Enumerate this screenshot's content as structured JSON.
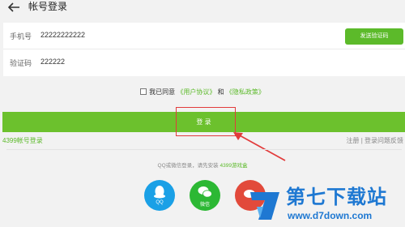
{
  "header": {
    "title": "帐号登录"
  },
  "form": {
    "phone_label": "手机号",
    "phone_value": "22222222222",
    "send_code_label": "发送验证码",
    "code_label": "验证码",
    "code_value": "222222"
  },
  "agreement": {
    "prefix": "我已同意",
    "user_agreement": "《用户协议》",
    "and": "和",
    "privacy_policy": "《隐私政策》"
  },
  "login_button": "登 录",
  "account_login": "4399帐号登录",
  "right_links": {
    "register": "注册",
    "separator": "|",
    "login_problem": "登录问题反馈"
  },
  "hint": {
    "text": "QQ或微信登录，请先安装",
    "app": "4399游戏盒"
  },
  "social": {
    "qq": "QQ",
    "wechat": "微信"
  },
  "watermark": {
    "brand": "第七下载站",
    "url": "www.d7down.com"
  },
  "colors": {
    "accent": "#6cc12d",
    "highlight": "#e23b3b",
    "brand_blue": "#1e78d2"
  }
}
